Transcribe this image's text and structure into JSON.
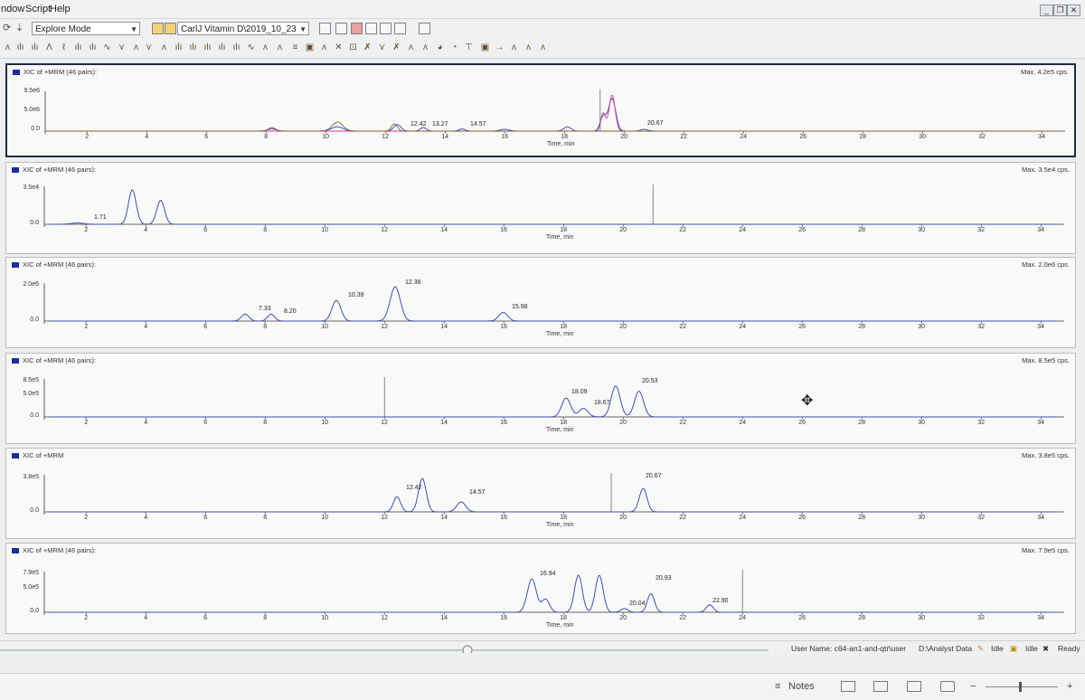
{
  "menu": {
    "items": [
      "ndow",
      "Script",
      "Help"
    ]
  },
  "toolbar": {
    "mode_value": "Explore Mode",
    "file_value": "CarlJ Vitamin D\\2019_10_23"
  },
  "x_axis": {
    "ticks": [
      "2",
      "4",
      "6",
      "8",
      "10",
      "12",
      "14",
      "16",
      "18",
      "20",
      "22",
      "24",
      "26",
      "28",
      "30",
      "32",
      "34"
    ],
    "title": "Time, min"
  },
  "panes": [
    {
      "title": "XIC of +MRM (46 pairs):",
      "max": "Max. 4.2e5 cps.",
      "y_labels": [
        "9.5e6",
        "5.0e6",
        "0.0"
      ],
      "peak_labels": [
        "12.42",
        "13.27",
        "14.57",
        "20.67"
      ]
    },
    {
      "title": "XIC of +MRM (46 pairs):",
      "max": "Max. 3.5e4 cps.",
      "y_labels": [
        "3.5e4",
        "0.0"
      ],
      "peak_labels": [
        "1.71"
      ]
    },
    {
      "title": "XIC of +MRM (46 pairs):",
      "max": "Max. 2.0e6 cps.",
      "y_labels": [
        "2.0e6",
        "0.0"
      ],
      "peak_labels": [
        "7.33",
        "8.20",
        "10.39",
        "12.36",
        "15.98"
      ]
    },
    {
      "title": "XIC of +MRM (46 pairs):",
      "max": "Max. 8.5e5 cps.",
      "y_labels": [
        "8.5e5",
        "5.0e5",
        "0.0"
      ],
      "peak_labels": [
        "18.09",
        "18.67",
        "20.53"
      ]
    },
    {
      "title": "XIC of +MRM",
      "max": "Max. 3.8e5 cps.",
      "y_labels": [
        "3.8e5",
        "0.0"
      ],
      "peak_labels": [
        "12.42",
        "14.57",
        "20.67"
      ]
    },
    {
      "title": "XIC of +MRM (46 pairs):",
      "max": "Max. 7.9e5 cps.",
      "y_labels": [
        "7.9e5",
        "5.0e5",
        "0.0"
      ],
      "peak_labels": [
        "16.94",
        "20.04",
        "20.93",
        "22.90"
      ]
    }
  ],
  "status": {
    "user": "User Name: c64-an1-and-qtr\\user",
    "data_path": "D:\\Analyst Data",
    "state1": "Idle",
    "state2": "Idle",
    "state3": "Ready"
  },
  "bottom": {
    "notes_label": "Notes"
  },
  "colors": {
    "trace": "#3a4fb8",
    "accent_pink": "#d4409a",
    "pane_border_active": "#1f2a44"
  }
}
